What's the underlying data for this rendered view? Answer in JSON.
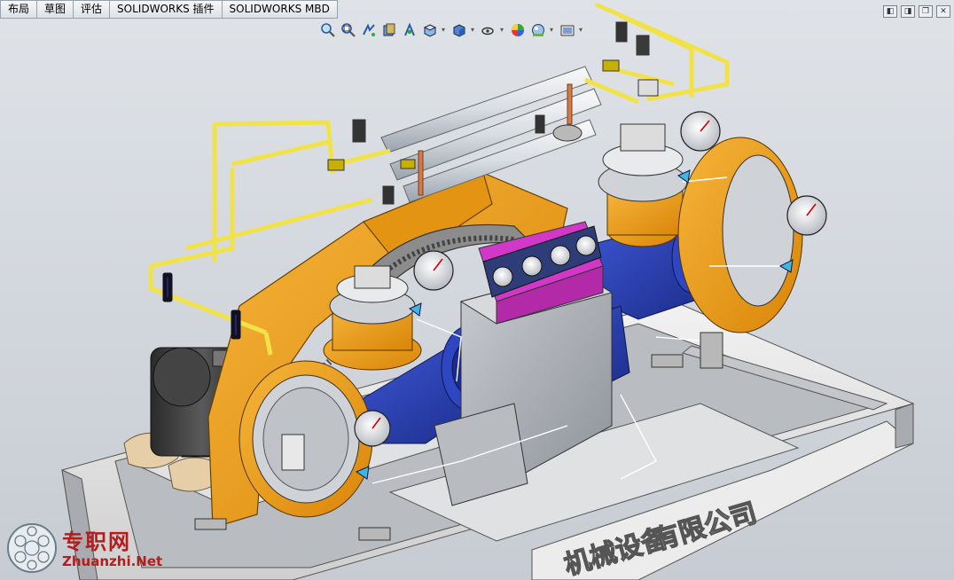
{
  "tabs": [
    "布局",
    "草图",
    "评估",
    "SOLIDWORKS 插件",
    "SOLIDWORKS MBD"
  ],
  "view_toolbar": {
    "icons": [
      "zoom-to-fit-icon",
      "zoom-to-area-icon",
      "previous-view-icon",
      "section-view-icon",
      "dynamic-annotation-icon",
      "view-orientation-icon",
      "display-style-icon",
      "hide-show-items-icon",
      "edit-appearance-icon",
      "apply-scene-icon",
      "view-settings-icon"
    ]
  },
  "window_controls": [
    "restore-icon",
    "tile-icon",
    "maximize-icon",
    "close-icon"
  ],
  "base_text": "有限公司",
  "base_text_partial": "机械设备",
  "watermark": {
    "cn": "专职网",
    "en": "Zhuanzhi.Net"
  },
  "colors": {
    "frame": "#e8e8e8",
    "blue": "#2a3fae",
    "orange": "#f0a11c",
    "magenta": "#d238c8",
    "pipe_yellow": "#f2e24a",
    "bg": "#d2d6dc"
  }
}
